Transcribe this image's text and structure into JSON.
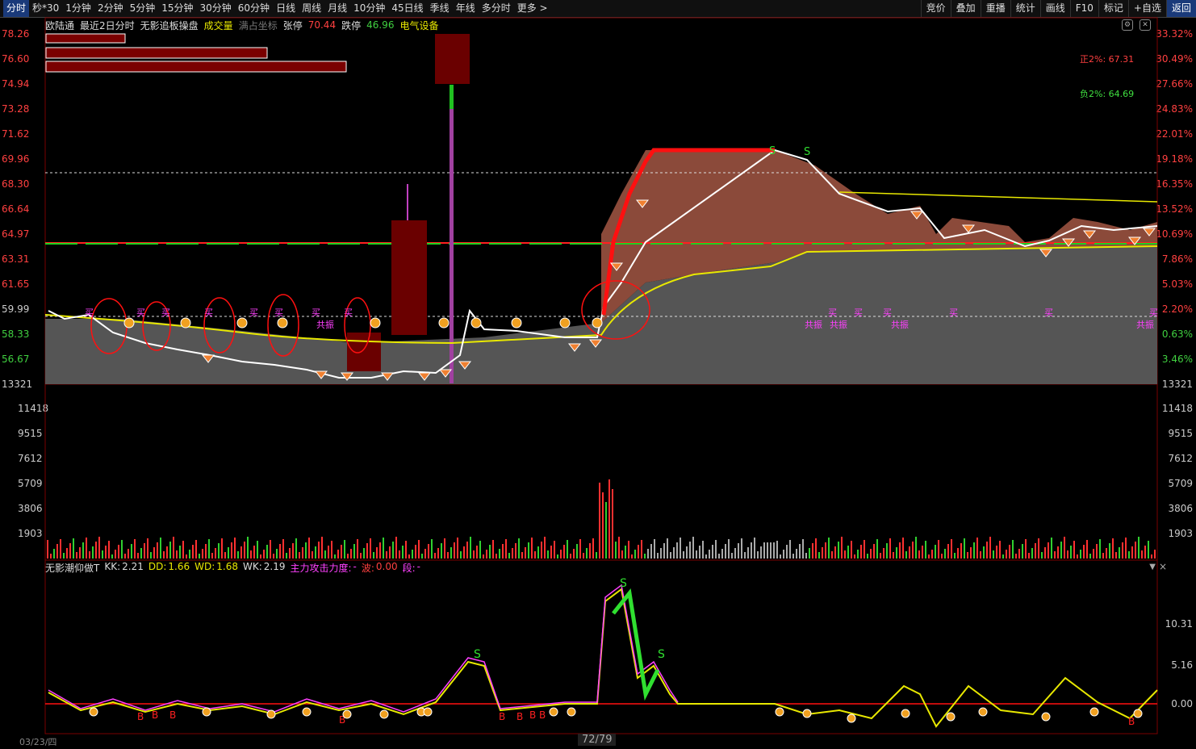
{
  "toolbar": {
    "tabs": [
      "分时",
      "秒*30",
      "1分钟",
      "2分钟",
      "5分钟",
      "15分钟",
      "30分钟",
      "60分钟",
      "日线",
      "周线",
      "月线",
      "10分钟",
      "45日线",
      "季线",
      "年线",
      "多分时",
      "更多 >"
    ],
    "active_tab": 0,
    "right_tools": [
      "竞价",
      "叠加",
      "重播",
      "统计",
      "画线",
      "F10",
      "标记",
      "+自选",
      "返回"
    ],
    "active_tool": 8
  },
  "info": {
    "stock_name": "欧陆通",
    "mode": "最近2日分时",
    "indicator_title": "无影追板操盘",
    "volume_label": "成交量",
    "coord_label": "满占坐标",
    "limit_up_label": "张停",
    "limit_up_value": "70.44",
    "limit_down_label": "跌停",
    "limit_down_value": "46.96",
    "sector": "电气设备"
  },
  "price_axis": {
    "left": [
      "78.26",
      "76.60",
      "74.94",
      "73.28",
      "71.62",
      "69.96",
      "68.30",
      "66.64",
      "64.97",
      "63.31",
      "61.65",
      "59.99",
      "58.33",
      "56.67",
      "13321"
    ],
    "right": [
      "33.32%",
      "30.49%",
      "27.66%",
      "24.83%",
      "22.01%",
      "19.18%",
      "16.35%",
      "13.52%",
      "10.69%",
      "7.86%",
      "5.03%",
      "2.20%",
      "0.63%",
      "3.46%",
      "13321"
    ]
  },
  "volume_axis": [
    "11418",
    "9515",
    "7612",
    "5709",
    "3806",
    "1903"
  ],
  "annotations": {
    "plus2": "正2%: 67.31",
    "minus2": "负2%: 64.69",
    "buy": "买",
    "resonance": "共振",
    "s_mark": "S",
    "b_mark": "B"
  },
  "indicator_panel": {
    "name": "无影潮仰做T",
    "kk_label": "KK:",
    "kk_value": "2.21",
    "dd_label": "DD:",
    "dd_value": "1.66",
    "wd_label": "WD:",
    "wd_value": "1.68",
    "wk_label": "WK:",
    "wk_value": "2.19",
    "force_label": "主力攻击力度:",
    "force_value": "-",
    "wave_label": "波:",
    "wave_value": "0.00",
    "seg_label": "段:",
    "seg_value": "-",
    "axis": [
      "10.31",
      "5.16",
      "0.00"
    ]
  },
  "footer": {
    "date": "03/23/四",
    "page": "72/79"
  },
  "colors": {
    "up": "#ff3030",
    "down": "#30d030",
    "price_line": "#ffffff",
    "avg_line": "#e8e800",
    "fill_brown": "#8b4a3a",
    "fill_gray": "#555555",
    "magenta": "#ff40ff",
    "grid": "#5a0000"
  }
}
